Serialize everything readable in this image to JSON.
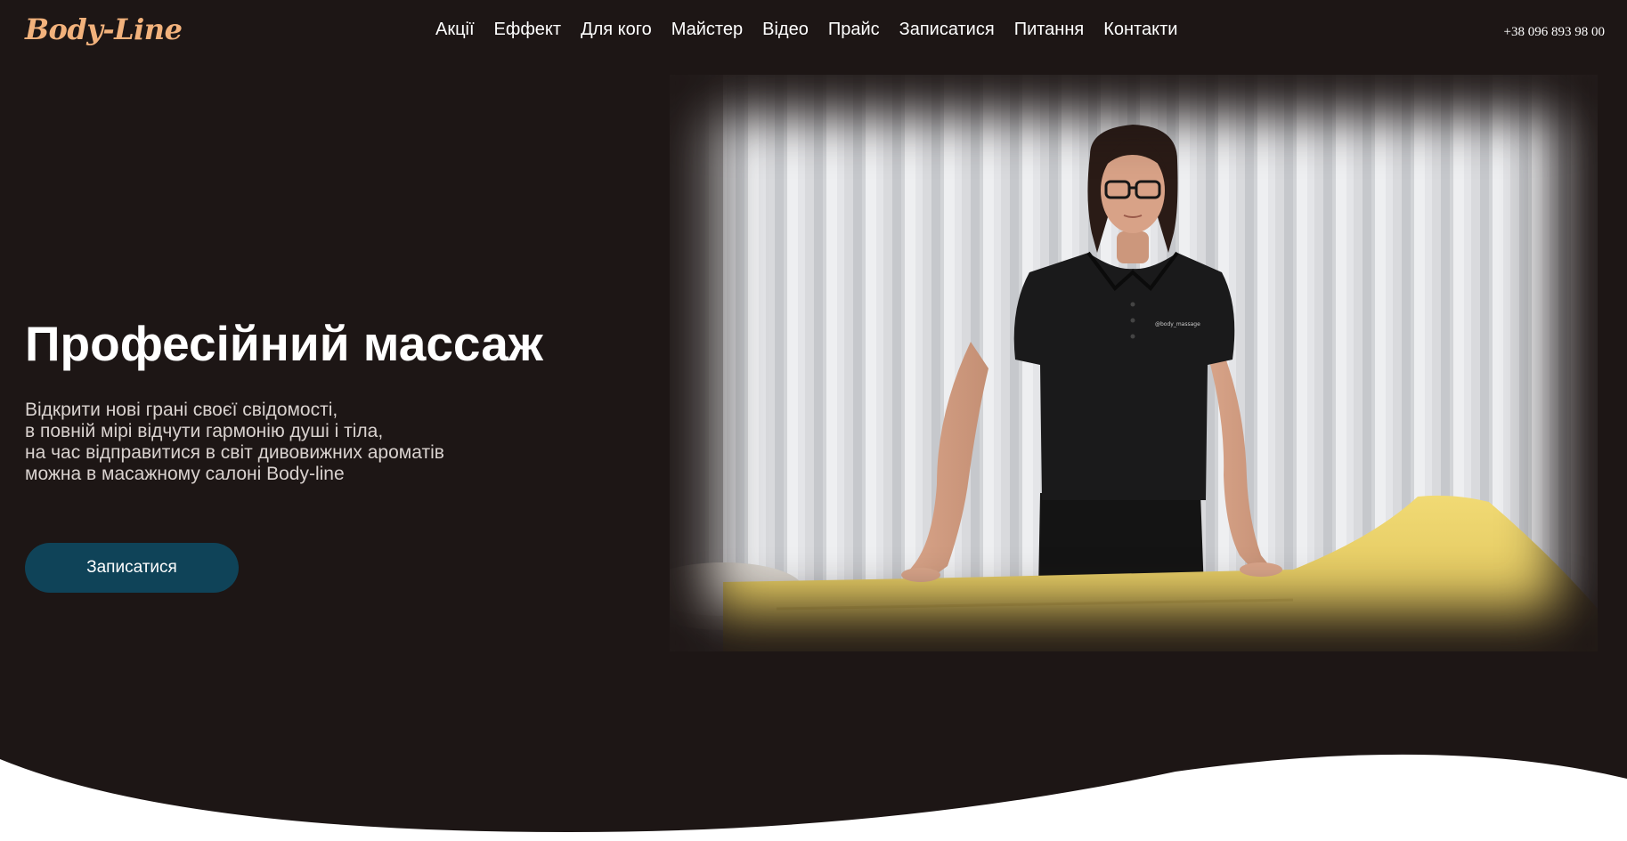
{
  "header": {
    "logo": "Body-Line",
    "nav": [
      "Акції",
      "Еффект",
      "Для кого",
      "Майстер",
      "Відео",
      "Прайс",
      "Записатися",
      "Питання",
      "Контакти"
    ],
    "phone": "+38 096 893 98 00"
  },
  "hero": {
    "title": "Професійний массаж",
    "subtitle_lines": [
      "Відкрити нові грані своєї свідомості,",
      "в повній мірі відчути гармонію душі і тіла,",
      "на час відправитися в світ дивовижних ароматів",
      "можна в масажному салоні Body-line"
    ],
    "cta_label": "Записатися",
    "shirt_text": "@body_massage"
  },
  "colors": {
    "background": "#1d1615",
    "logo": "#f2b27c",
    "cta": "#0f4358",
    "text": "#ffffff"
  }
}
